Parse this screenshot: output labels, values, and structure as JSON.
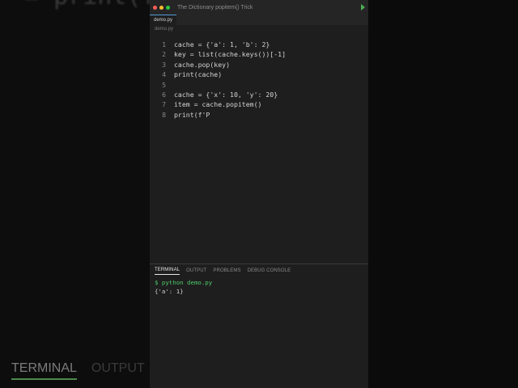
{
  "background": {
    "code_fragment": "= print(f'P",
    "tabs": [
      {
        "label": "TERMINAL",
        "active": true
      },
      {
        "label": "OUTPUT",
        "active": false
      }
    ]
  },
  "window": {
    "title": "The Dictionary popitem() Trick",
    "dots": [
      "#ff5f57",
      "#febc2e",
      "#28c840"
    ]
  },
  "editor": {
    "tab_label": "demo.py",
    "breadcrumb": "demo.py",
    "lines": [
      {
        "n": "1",
        "code": "cache = {'a': 1, 'b': 2}"
      },
      {
        "n": "2",
        "code": "key = list(cache.keys())[-1]"
      },
      {
        "n": "3",
        "code": "cache.pop(key)"
      },
      {
        "n": "4",
        "code": "print(cache)"
      },
      {
        "n": "5",
        "code": ""
      },
      {
        "n": "6",
        "code": "cache = {'x': 10, 'y': 20}"
      },
      {
        "n": "7",
        "code": "item = cache.popitem()"
      },
      {
        "n": "8",
        "code": "print(f'P"
      }
    ]
  },
  "panel": {
    "tabs": [
      {
        "label": "TERMINAL",
        "active": true
      },
      {
        "label": "OUTPUT",
        "active": false
      },
      {
        "label": "PROBLEMS",
        "active": false
      },
      {
        "label": "DEBUG CONSOLE",
        "active": false
      }
    ],
    "command": "$ python demo.py",
    "output": "{'a': 1}"
  }
}
